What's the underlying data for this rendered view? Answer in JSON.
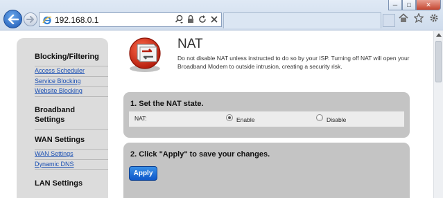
{
  "browser": {
    "address": "192.168.0.1",
    "window_buttons": {
      "minimize": "─",
      "maximize": "□",
      "close": "✕"
    },
    "icons": [
      "back-arrow-icon",
      "forward-arrow-icon",
      "ie-logo-icon",
      "search-icon",
      "lock-icon",
      "refresh-icon",
      "close-icon",
      "home-icon",
      "star-icon",
      "gear-icon"
    ],
    "back_button_color": "#1c57b3"
  },
  "sidebar": {
    "sections": [
      {
        "heading": "Blocking/Filtering",
        "links": [
          "Access Scheduler",
          "Service Blocking",
          "Website Blocking"
        ]
      },
      {
        "heading": "Broadband Settings",
        "links": []
      },
      {
        "heading": "WAN Settings",
        "links": [
          "WAN Settings",
          "Dynamic DNS"
        ]
      },
      {
        "heading": "LAN Settings",
        "links": []
      }
    ],
    "link_color": "#1a4fb3"
  },
  "page": {
    "title": "NAT",
    "description": "Do not disable NAT unless instructed to do so by your ISP. Turning off NAT will open your Broadband Modem to outside intrusion, creating a security risk.",
    "logo_icon": "nat-router-icon"
  },
  "step1": {
    "title": "1. Set the NAT state.",
    "label": "NAT:",
    "options": [
      {
        "label": "Enable",
        "selected": true
      },
      {
        "label": "Disable",
        "selected": false
      }
    ]
  },
  "step2": {
    "title": "2. Click \"Apply\" to save your changes.",
    "apply_label": "Apply",
    "apply_color": "#0d57c9"
  }
}
